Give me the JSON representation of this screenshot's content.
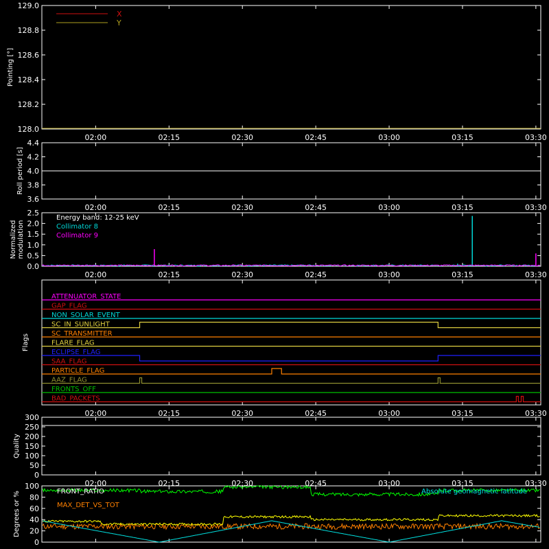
{
  "colors": {
    "background": "#000000",
    "axes": "#ffffff",
    "x": "#d01010",
    "y": "#b0a020",
    "roll": "#ffffff",
    "c8": "#00d8d8",
    "c9": "#ff00ff",
    "front_ratio": "#00ff00",
    "max_det": "#ff8000",
    "geomag": "#00e0e0",
    "yellow": "#ffff00"
  },
  "time_ticks": [
    "02:00",
    "02:15",
    "02:30",
    "02:45",
    "03:00",
    "03:15",
    "03:30"
  ],
  "chart_data": [
    {
      "type": "line",
      "panel": "pointing",
      "ylabel": "Pointing [°]",
      "ylim": [
        128.0,
        129.0
      ],
      "yticks": [
        "129.0",
        "128.8",
        "128.6",
        "128.4",
        "128.2",
        "128.0"
      ],
      "xlim": [
        "01:49",
        "03:31"
      ],
      "legend_position": "top-left",
      "series": [
        {
          "name": "X",
          "color_key": "x",
          "values": []
        },
        {
          "name": "Y",
          "color_key": "y",
          "values": []
        }
      ]
    },
    {
      "type": "line",
      "panel": "roll",
      "ylabel": "Roll period [s]",
      "ylim": [
        3.5,
        4.5
      ],
      "yticks": [
        "4.4",
        "4.2",
        "4.0",
        "3.8",
        "3.6"
      ],
      "series": [
        {
          "name": "",
          "color_key": "roll",
          "x": [
            "01:49",
            "03:31"
          ],
          "values": [
            4.0,
            4.0
          ]
        }
      ]
    },
    {
      "type": "line",
      "panel": "modulation",
      "ylabel": [
        "Normalized",
        "modulation"
      ],
      "ylim": [
        0,
        2.5
      ],
      "yticks": [
        "2.5",
        "2.0",
        "1.5",
        "1.0",
        "0.5",
        "0.0"
      ],
      "legend_position": "top-left",
      "legend_title": "Energy band: 12-25 keV",
      "baseline": 0.04,
      "series": [
        {
          "name": "Collimator 8",
          "color_key": "c8",
          "spikes": [
            {
              "t": "03:17",
              "v": 2.35
            },
            {
              "t": "03:14",
              "v": 0.12
            }
          ]
        },
        {
          "name": "Collimator 9",
          "color_key": "c9",
          "spikes": [
            {
              "t": "02:12",
              "v": 0.8
            },
            {
              "t": "03:30",
              "v": 0.6
            }
          ]
        }
      ]
    },
    {
      "type": "line",
      "panel": "flags",
      "ylabel": "Flags",
      "flags": [
        {
          "name": "ATTENUATOR_STATE",
          "color_key": "c9",
          "segments": []
        },
        {
          "name": "GAP_FLAG",
          "color_key": "x",
          "segments": []
        },
        {
          "name": "NON_SOLAR_EVENT",
          "color_key": "c8",
          "segments": []
        },
        {
          "name": "SC_IN_SUNLIGHT",
          "color": "#e0d040",
          "segments": [
            [
              "02:09",
              "03:10"
            ]
          ]
        },
        {
          "name": "SC_TRANSMITTER",
          "color_key": "max_det",
          "segments": []
        },
        {
          "name": "FLARE_FLAG",
          "color": "#e0d040",
          "segments": []
        },
        {
          "name": "ECLIPSE_FLAG",
          "color": "#2020ff",
          "inverted": true,
          "segments": [
            [
              "02:09",
              "03:10"
            ]
          ]
        },
        {
          "name": "SAA_FLAG",
          "color_key": "x",
          "segments": []
        },
        {
          "name": "PARTICLE_FLAG",
          "color_key": "max_det",
          "segments": [
            [
              "02:36",
              "02:38"
            ]
          ]
        },
        {
          "name": "AAZ_FLAG",
          "color": "#909030",
          "segments": [
            [
              "02:09",
              "02:09"
            ],
            [
              "03:10",
              "03:10"
            ]
          ]
        },
        {
          "name": "FRONTS_OFF",
          "color": "#00c000",
          "segments": []
        },
        {
          "name": "BAD_PACKETS",
          "color_key": "x",
          "segments": [
            [
              "03:26",
              "03:26"
            ],
            [
              "03:27",
              "03:27"
            ]
          ]
        }
      ]
    },
    {
      "type": "line",
      "panel": "quality",
      "ylabel": "Quality",
      "ylim": [
        0,
        300
      ],
      "yticks": [
        "300",
        "250",
        "200",
        "150",
        "100",
        "50",
        "0"
      ],
      "series": [
        {
          "name": "",
          "color_key": "roll",
          "x": [
            "01:49",
            "03:31"
          ],
          "values": [
            0,
            0
          ]
        }
      ]
    },
    {
      "type": "line",
      "panel": "orbit",
      "ylabel": "Degrees or %",
      "ylim": [
        0,
        100
      ],
      "yticks": [
        "100",
        "80",
        "60",
        "40",
        "20",
        "0"
      ],
      "series": [
        {
          "name": "FRONT_RATIO",
          "color_key": "front_ratio",
          "x": [
            "01:49",
            "02:09",
            "02:09",
            "02:26",
            "02:26",
            "02:44",
            "02:44",
            "03:10",
            "03:10",
            "03:31"
          ],
          "values": [
            92,
            92,
            90,
            90,
            98,
            98,
            85,
            85,
            92,
            92
          ]
        },
        {
          "name": "MAX_DET_VS_TOT",
          "color_key": "max_det",
          "x": [
            "01:49",
            "03:31"
          ],
          "values": [
            28,
            28
          ]
        },
        {
          "name": "",
          "color_key": "yellow",
          "x": [
            "01:49",
            "02:01",
            "02:01",
            "02:26",
            "02:26",
            "02:44",
            "02:44",
            "03:10",
            "03:10",
            "03:31"
          ],
          "values": [
            37,
            37,
            32,
            32,
            45,
            45,
            40,
            40,
            47,
            47
          ]
        },
        {
          "name": "Absolute geomagnetic latitude",
          "color_key": "geomag",
          "x": [
            "01:49",
            "02:13",
            "02:36",
            "03:00",
            "03:23",
            "03:31"
          ],
          "values": [
            38,
            0,
            38,
            0,
            38,
            26
          ]
        }
      ]
    }
  ]
}
